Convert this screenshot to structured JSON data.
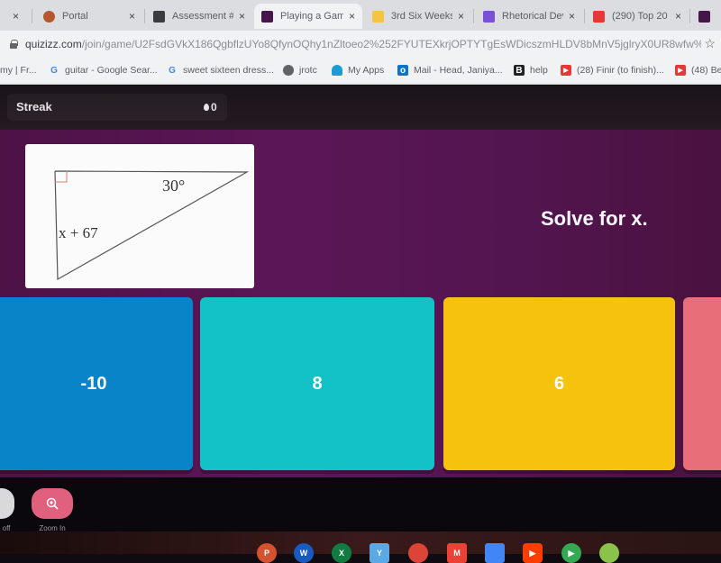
{
  "browser": {
    "tabs": [
      {
        "title": "",
        "favicon": "none",
        "close": "×"
      },
      {
        "title": "Portal",
        "favicon": "avatar-icon",
        "close": "×"
      },
      {
        "title": "Assessment #",
        "favicon": "account-box-icon",
        "close": "×"
      },
      {
        "title": "Playing a Gam",
        "favicon": "quizizz-icon",
        "close": "×",
        "active": true
      },
      {
        "title": "3rd Six Weeks",
        "favicon": "slides-icon",
        "close": "×"
      },
      {
        "title": "Rhetorical Dev",
        "favicon": "classroom-icon",
        "close": "×"
      },
      {
        "title": "(290) Top 20",
        "favicon": "youtube-icon",
        "close": "×"
      },
      {
        "title": "",
        "favicon": "quizizz-icon",
        "close": ""
      }
    ],
    "url_host": "quizizz.com",
    "url_path": "/join/game/U2FsdGVkX186QgbflzUYo8QfynOQhy1nZltoeo2%252FYUTEXkrjOPTYTgEsWDicszmHLDV8bMnV5jglryX0UR8wfw%2...",
    "star_icon": "☆",
    "bookmarks": [
      {
        "label": "my | Fr...",
        "icon": "none"
      },
      {
        "label": "guitar - Google Sear...",
        "icon": "google-icon"
      },
      {
        "label": "sweet sixteen dress...",
        "icon": "google-icon"
      },
      {
        "label": "jrotc",
        "icon": "globe-icon"
      },
      {
        "label": "My Apps",
        "icon": "cloud-icon"
      },
      {
        "label": "Mail - Head, Janiya...",
        "icon": "outlook-icon"
      },
      {
        "label": "help",
        "icon": "bookmark-b-icon"
      },
      {
        "label": "(28) Finir (to finish)...",
        "icon": "youtube-icon"
      },
      {
        "label": "(48) Be",
        "icon": "youtube-icon"
      }
    ]
  },
  "game": {
    "streak_label": "Streak",
    "streak_count": "0",
    "question_text": "Solve for x.",
    "figure": {
      "angle_label": "30°",
      "side_label": "x + 67"
    },
    "options": [
      {
        "label": "-10",
        "color": "#0a84c9"
      },
      {
        "label": "8",
        "color": "#12c2c6"
      },
      {
        "label": "6",
        "color": "#f5c20e"
      },
      {
        "label": "",
        "color": "#e86f79"
      }
    ],
    "controls": [
      {
        "label": "off"
      },
      {
        "label": "Zoom In"
      }
    ]
  },
  "shelf": {
    "apps": [
      {
        "name": "PowerPoint",
        "letter": "P",
        "color": "#d35230"
      },
      {
        "name": "Word",
        "letter": "W",
        "color": "#185abd"
      },
      {
        "name": "Excel",
        "letter": "X",
        "color": "#107c41"
      },
      {
        "name": "App",
        "letter": "Y",
        "color": "#5aa9e6"
      },
      {
        "name": "Chrome",
        "letter": "",
        "color": "#db4437"
      },
      {
        "name": "Gmail",
        "letter": "M",
        "color": "#ea4335"
      },
      {
        "name": "Docs",
        "letter": "",
        "color": "#4285f4"
      },
      {
        "name": "YouTube",
        "letter": "▶",
        "color": "#ff3d00"
      },
      {
        "name": "Play Store",
        "letter": "▶",
        "color": "#34a853"
      },
      {
        "name": "App",
        "letter": "",
        "color": "#8bc34a"
      }
    ]
  }
}
